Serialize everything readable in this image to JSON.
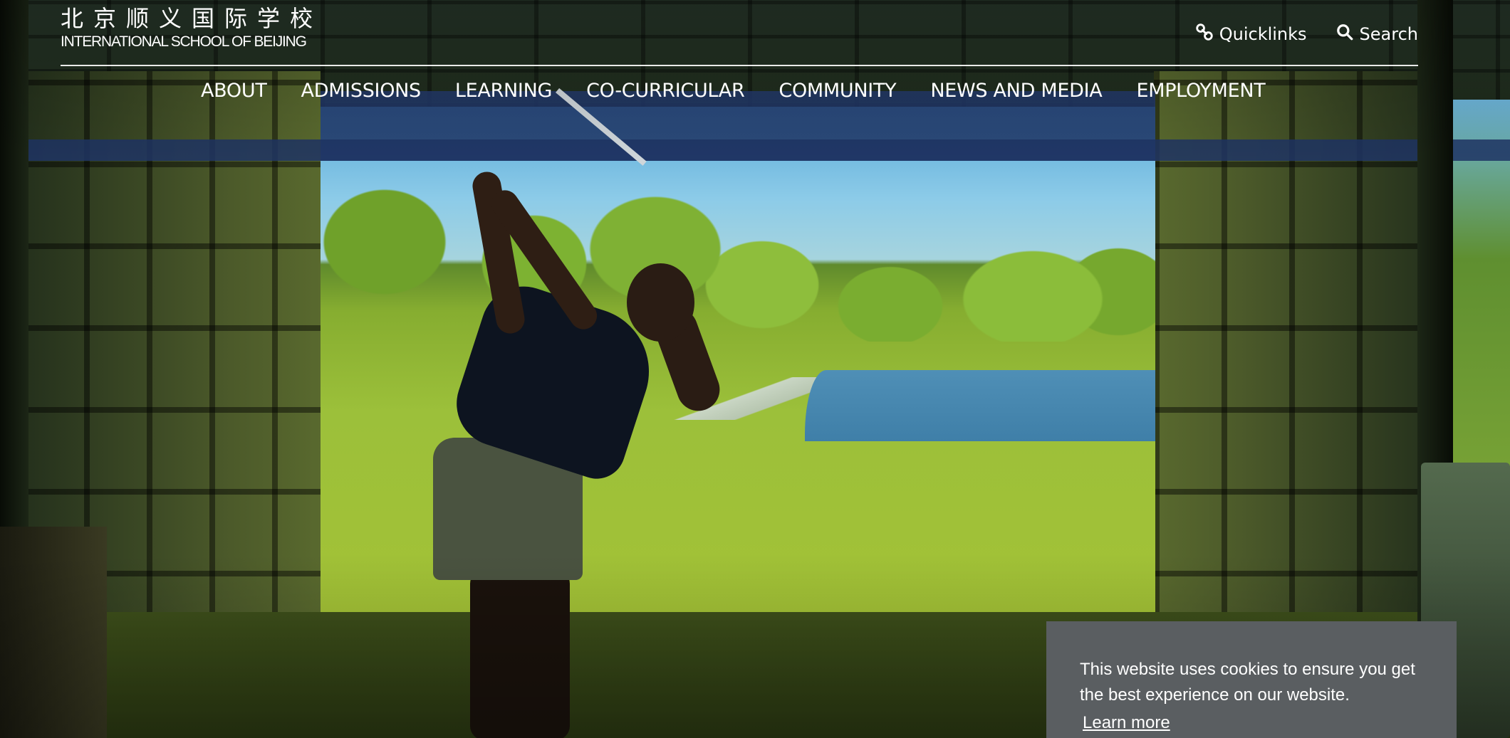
{
  "header": {
    "logo_cn": "北京顺义国际学校",
    "logo_en": "INTERNATIONAL SCHOOL OF BEIJING",
    "quicklinks_label": "Quicklinks",
    "search_label": "Search"
  },
  "nav": {
    "items": [
      {
        "label": "ABOUT"
      },
      {
        "label": "ADMISSIONS"
      },
      {
        "label": "LEARNING"
      },
      {
        "label": "CO-CURRICULAR"
      },
      {
        "label": "COMMUNITY"
      },
      {
        "label": "NEWS AND MEDIA"
      },
      {
        "label": "EMPLOYMENT"
      }
    ]
  },
  "cookie": {
    "message": "This website uses cookies to ensure you get the best experience on our website.",
    "learn_more": "Learn more"
  },
  "colors": {
    "header_text": "#ffffff",
    "cookie_bg": "#5a5e61"
  },
  "icons": {
    "quicklinks": "link-icon",
    "search": "search-icon"
  }
}
